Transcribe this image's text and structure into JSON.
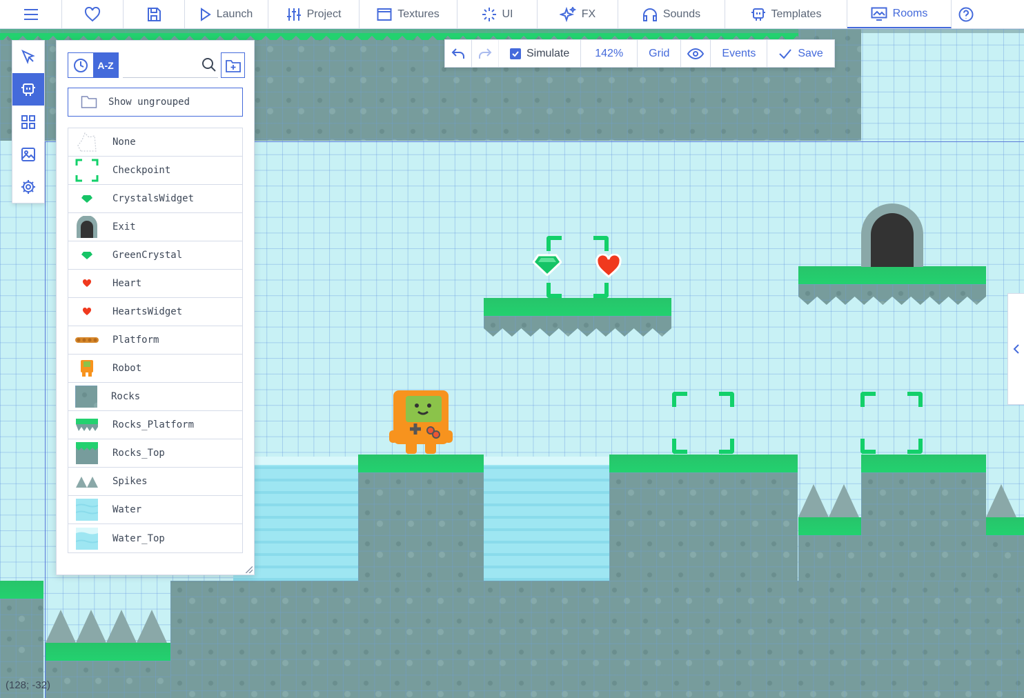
{
  "menubar": {
    "items": [
      {
        "label": "",
        "icon": "menu-icon"
      },
      {
        "label": "",
        "icon": "heart-icon"
      },
      {
        "label": "",
        "icon": "save-icon"
      },
      {
        "label": "Launch",
        "icon": "play-icon"
      },
      {
        "label": "Project",
        "icon": "sliders-icon"
      },
      {
        "label": "Textures",
        "icon": "texture-icon"
      },
      {
        "label": "UI",
        "icon": "ui-icon"
      },
      {
        "label": "FX",
        "icon": "sparkles-icon"
      },
      {
        "label": "Sounds",
        "icon": "headphones-icon"
      },
      {
        "label": "Templates",
        "icon": "template-icon"
      },
      {
        "label": "Rooms",
        "icon": "room-icon"
      },
      {
        "label": "",
        "icon": "help-icon"
      }
    ],
    "active": "Rooms"
  },
  "room_toolbar": {
    "simulate_label": "Simulate",
    "simulate_checked": true,
    "zoom_label": "142%",
    "grid_label": "Grid",
    "events_label": "Events",
    "save_label": "Save"
  },
  "left_tools": [
    "select-icon",
    "templates-icon",
    "tiles-icon",
    "backgrounds-icon",
    "settings-icon"
  ],
  "template_panel": {
    "sort_az_label": "A-Z",
    "search_value": "",
    "show_ungrouped_label": "Show ungrouped",
    "templates": [
      {
        "name": "None",
        "thumb": "none"
      },
      {
        "name": "Checkpoint",
        "thumb": "checkpoint"
      },
      {
        "name": "CrystalsWidget",
        "thumb": "crystal"
      },
      {
        "name": "Exit",
        "thumb": "exit"
      },
      {
        "name": "GreenCrystal",
        "thumb": "crystal"
      },
      {
        "name": "Heart",
        "thumb": "heart"
      },
      {
        "name": "HeartsWidget",
        "thumb": "heart"
      },
      {
        "name": "Platform",
        "thumb": "platform"
      },
      {
        "name": "Robot",
        "thumb": "robot"
      },
      {
        "name": "Rocks",
        "thumb": "rocks"
      },
      {
        "name": "Rocks_Platform",
        "thumb": "rocks-platform"
      },
      {
        "name": "Rocks_Top",
        "thumb": "rocks-top"
      },
      {
        "name": "Spikes",
        "thumb": "spikes"
      },
      {
        "name": "Water",
        "thumb": "water"
      },
      {
        "name": "Water_Top",
        "thumb": "water-top"
      }
    ]
  },
  "status": {
    "cursor_coords": "(128; -32)"
  },
  "colors": {
    "accent": "#446adb",
    "grass": "#23d16f",
    "rock": "#779c9c",
    "sky": "#c8f1f5",
    "water": "#9ee6f2",
    "heart": "#f0391e",
    "robot": "#f7931e"
  }
}
